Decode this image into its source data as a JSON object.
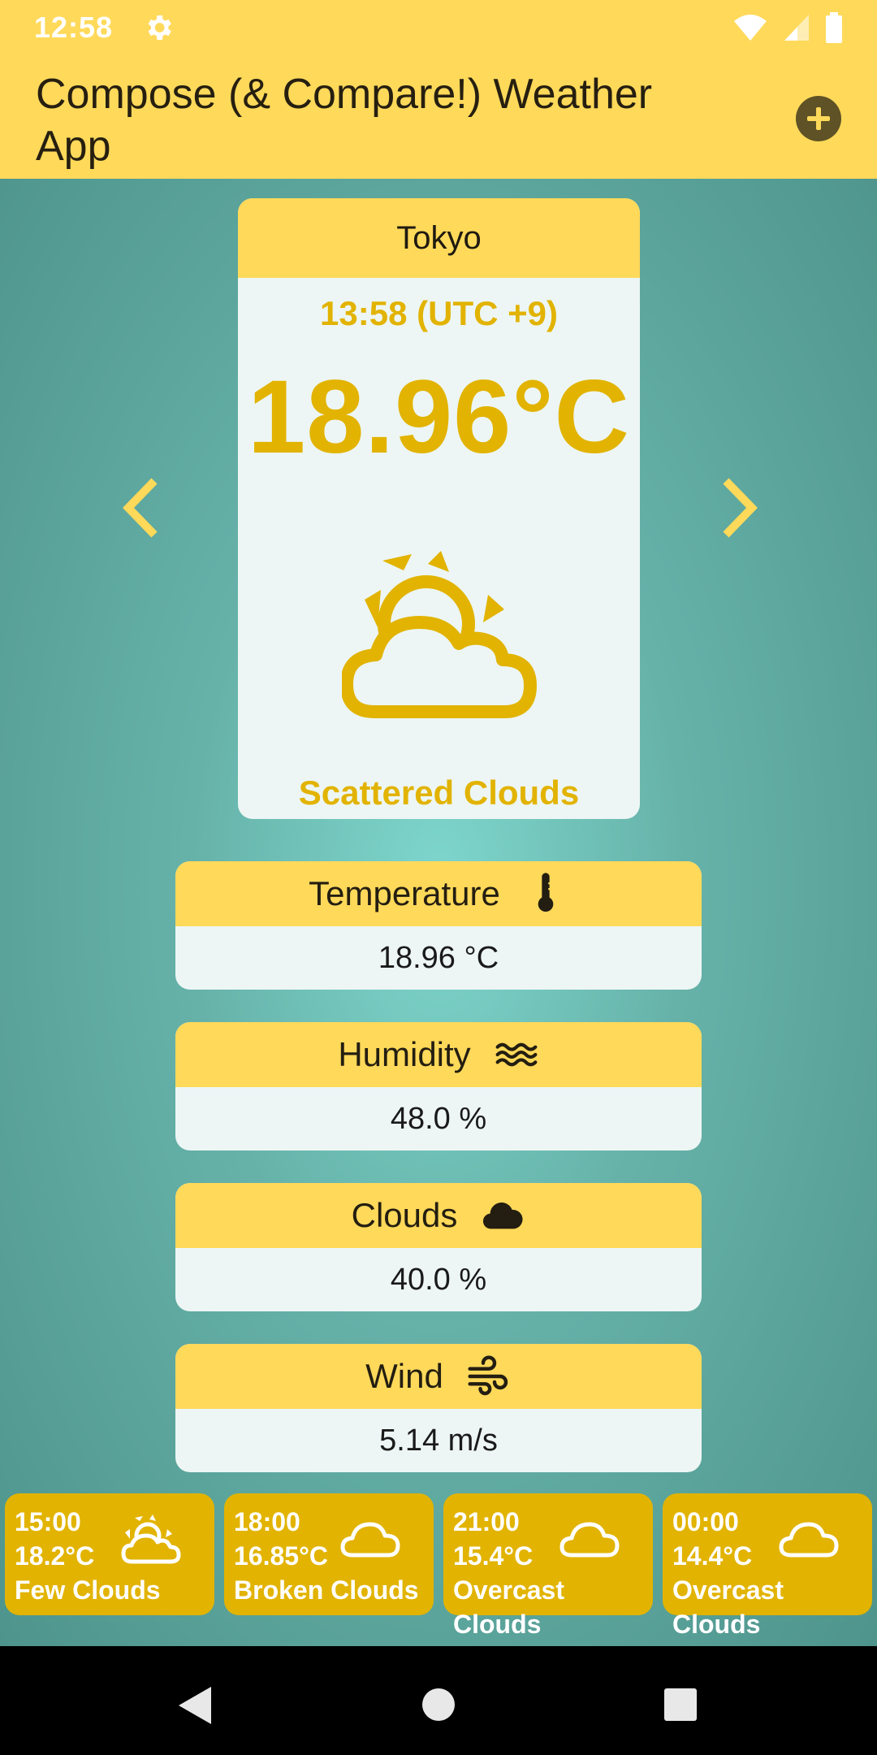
{
  "status_bar": {
    "time": "12:58"
  },
  "app_bar": {
    "title": "Compose (& Compare!) Weather App"
  },
  "main_card": {
    "city": "Tokyo",
    "local_time": "13:58 (UTC +9)",
    "temperature": "18.96°C",
    "description": "Scattered Clouds"
  },
  "stats": {
    "temperature": {
      "label": "Temperature",
      "value": "18.96 °C"
    },
    "humidity": {
      "label": "Humidity",
      "value": "48.0 %"
    },
    "clouds": {
      "label": "Clouds",
      "value": "40.0 %"
    },
    "wind": {
      "label": "Wind",
      "value": "5.14 m/s"
    }
  },
  "forecast": [
    {
      "time": "15:00",
      "temp": "18.2°C",
      "desc": "Few Clouds",
      "icon": "sun-cloud-icon"
    },
    {
      "time": "18:00",
      "temp": "16.85°C",
      "desc": "Broken Clouds",
      "icon": "cloud-icon"
    },
    {
      "time": "21:00",
      "temp": "15.4°C",
      "desc": "Overcast Clouds",
      "icon": "cloud-icon"
    },
    {
      "time": "00:00",
      "temp": "14.4°C",
      "desc": "Overcast Clouds",
      "icon": "cloud-icon"
    }
  ],
  "colors": {
    "primary": "#FFD95A",
    "accent": "#E2B300",
    "background": "#66B2A9",
    "card": "#EDF6F4"
  }
}
